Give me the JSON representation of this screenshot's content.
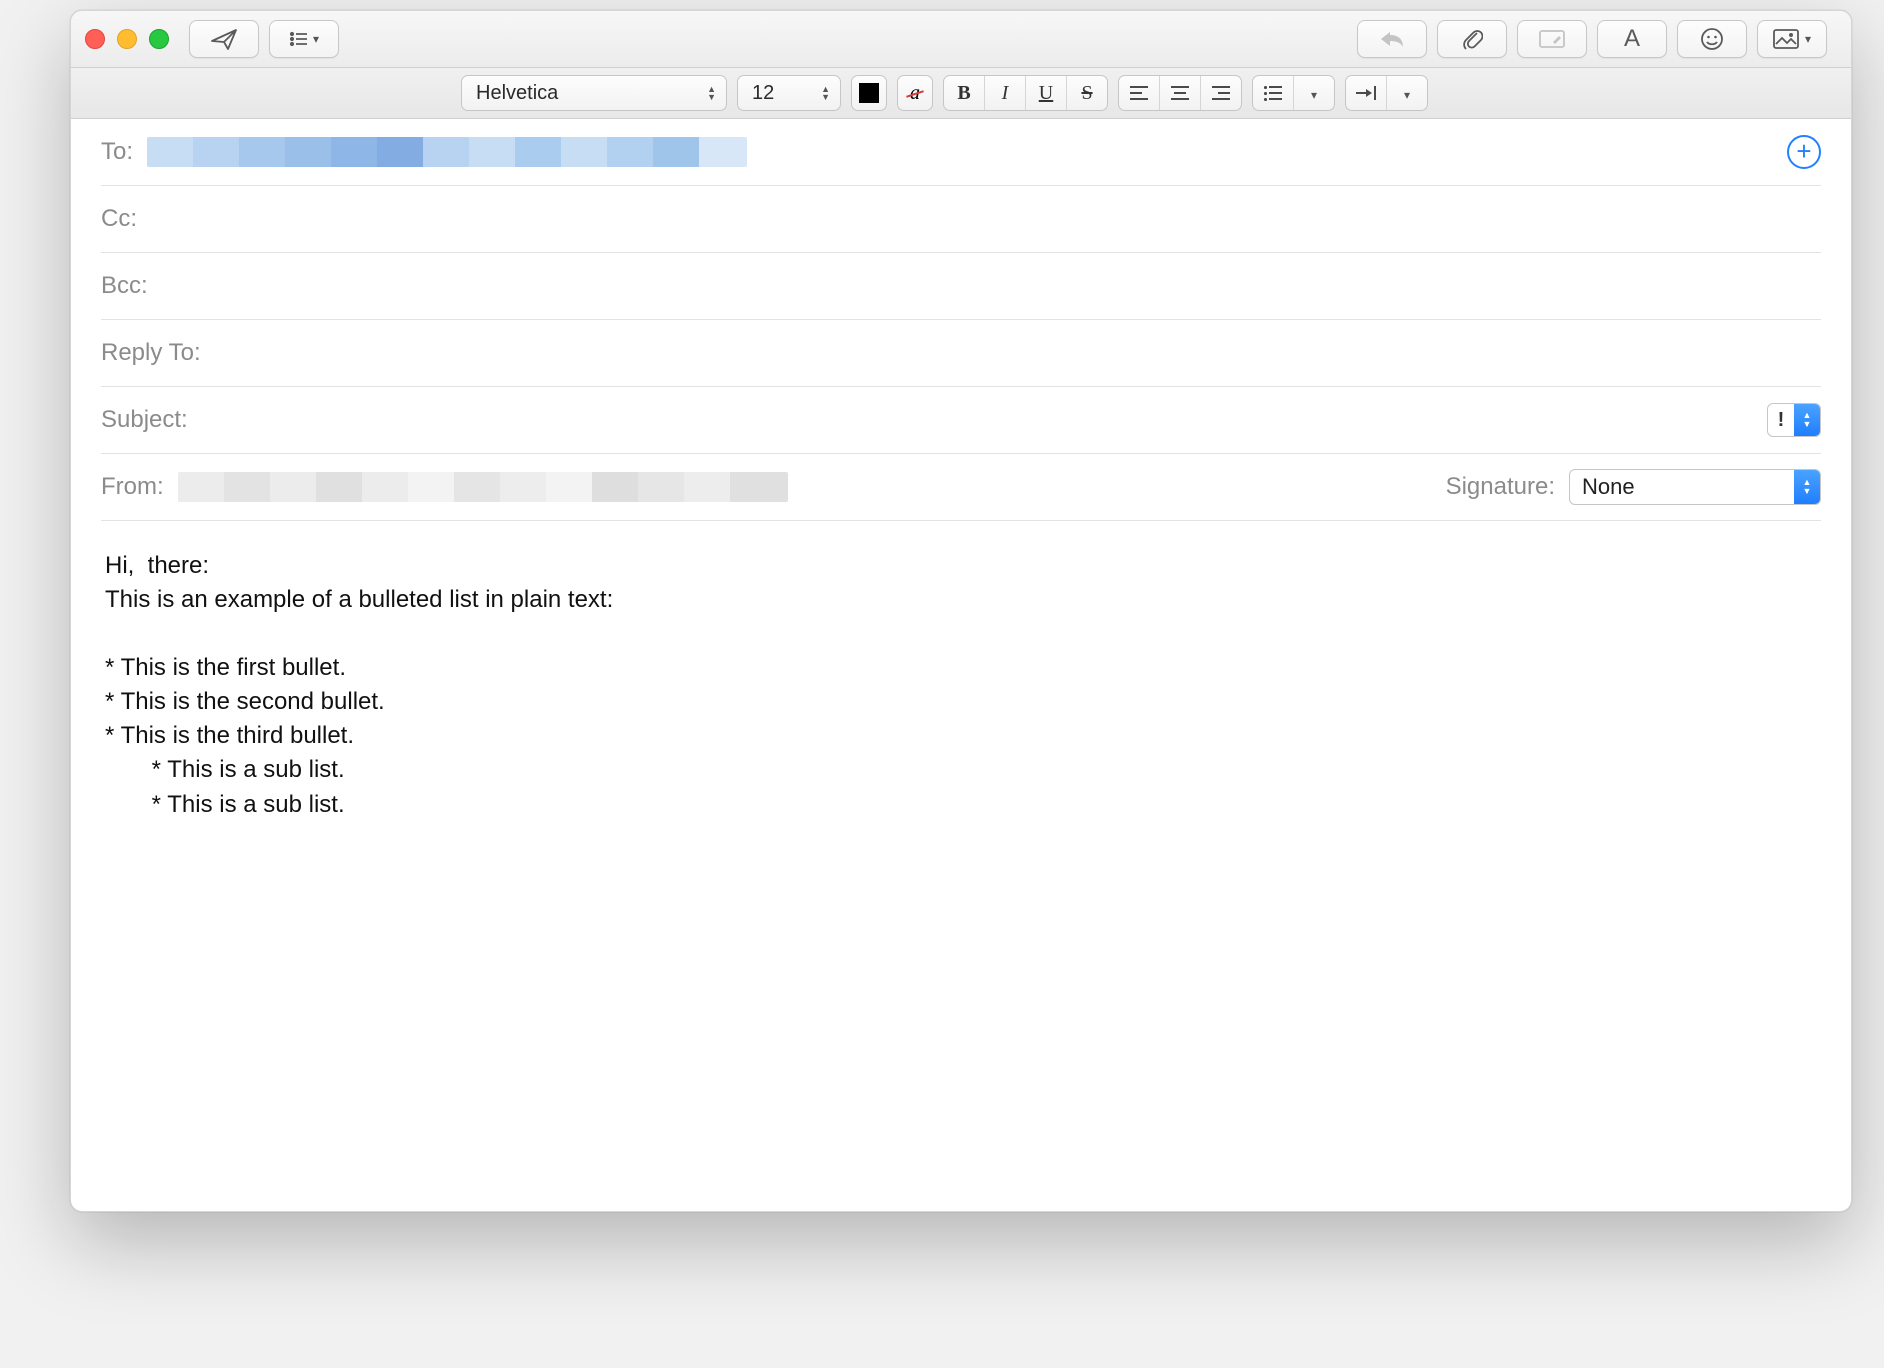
{
  "toolbar": {
    "icons": {
      "send": "send-icon",
      "header_options": "header-fields-icon",
      "reply": "reply-icon",
      "attach": "paperclip-icon",
      "markup": "markup-icon",
      "format": "format-icon",
      "emoji": "emoji-icon",
      "photo": "photo-browser-icon"
    }
  },
  "format_bar": {
    "font_family": "Helvetica",
    "font_size": "12",
    "text_color": "#000000",
    "bold": "B",
    "italic": "I",
    "underline": "U",
    "strike": "S",
    "list_icon": "bulleted-list-icon",
    "indent_icon": "indent-icon"
  },
  "fields": {
    "to_label": "To:",
    "cc_label": "Cc:",
    "bcc_label": "Bcc:",
    "reply_to_label": "Reply To:",
    "subject_label": "Subject:",
    "from_label": "From:",
    "signature_label": "Signature:",
    "signature_value": "None",
    "priority_marker": "!"
  },
  "body": {
    "text": "Hi,  there:\nThis is an example of a bulleted list in plain text:\n\n* This is the first bullet.\n* This is the second bullet.\n* This is the third bullet.\n       * This is a sub list.\n       * This is a sub list."
  }
}
